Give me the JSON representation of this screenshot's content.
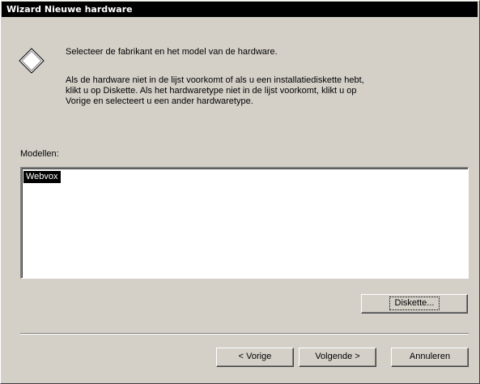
{
  "window": {
    "title": "Wizard Nieuwe hardware"
  },
  "header": {
    "icon": "diamond-icon",
    "heading": "Selecteer de fabrikant en het model van de hardware.",
    "description_lines": [
      "Als de hardware niet in de lijst voorkomt of als u een installatiediskette hebt,",
      "klikt u op Diskette. Als het hardwaretype niet in de lijst voorkomt, klikt u op",
      "Vorige en selecteert u een ander hardwaretype."
    ]
  },
  "models": {
    "label": "Modellen:",
    "items": [
      "Webvox"
    ],
    "selected_index": 0
  },
  "buttons": {
    "diskette": "Diskette...",
    "back": "< Vorige",
    "next": "Volgende >",
    "cancel": "Annuleren"
  }
}
